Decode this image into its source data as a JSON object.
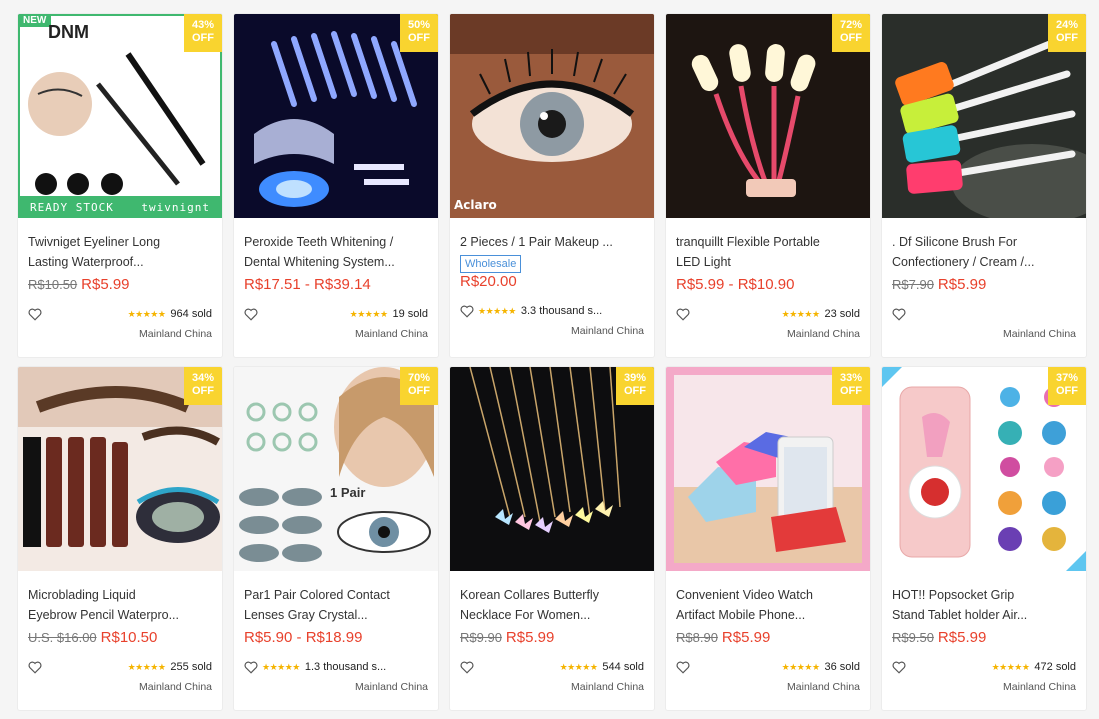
{
  "products": [
    {
      "title1": "Twivniget Eyeliner Long",
      "title2": "Lasting Waterproof...",
      "old_price": "R$10.50",
      "price": "R$5.99",
      "stars": "★★★★★",
      "sold": "964 sold",
      "origin": "Mainland China",
      "discount": [
        "43%",
        "OFF"
      ],
      "new_label": "NEW",
      "brand": "DNM",
      "banner_left": "READY STOCK",
      "banner_right": "twivnignt"
    },
    {
      "title1": "Peroxide Teeth Whitening /",
      "title2": "Dental Whitening System...",
      "old_price": "",
      "price": "R$17.51 - R$39.14",
      "stars": "★★★★★",
      "sold": "19 sold",
      "origin": "Mainland China",
      "discount": [
        "50%",
        "OFF"
      ]
    },
    {
      "title1": "2 Pieces / 1 Pair Makeup ...",
      "title2": "",
      "tag": "Wholesale",
      "old_price": "",
      "price": "R$20.00",
      "stars": "★★★★★",
      "sold": "3.3 thousand s...",
      "origin": "Mainland China",
      "discount": null,
      "image_caption": "Aclaro"
    },
    {
      "title1": "tranquillt Flexible Portable",
      "title2": "LED Light",
      "old_price": "",
      "price": "R$5.99 - R$10.90",
      "stars": "★★★★★",
      "sold": "23 sold",
      "origin": "Mainland China",
      "discount": [
        "72%",
        "OFF"
      ]
    },
    {
      "title1": ". Df Silicone Brush For",
      "title2": "Confectionery / Cream /...",
      "old_price": "R$7.90",
      "price": "R$5.99",
      "stars": "",
      "sold": "",
      "origin": "Mainland China",
      "discount": [
        "24%",
        "OFF"
      ]
    },
    {
      "title1": "Microblading Liquid",
      "title2": "Eyebrow Pencil Waterpro...",
      "old_price": "U.S. $16.00",
      "price": "R$10.50",
      "stars": "★★★★★",
      "sold": "255 sold",
      "origin": "Mainland China",
      "discount": [
        "34%",
        "OFF"
      ]
    },
    {
      "title1": "Par1 Pair Colored Contact",
      "title2": "Lenses Gray Crystal...",
      "old_price": "",
      "price": "R$5.90 - R$18.99",
      "stars": "★★★★★",
      "sold": "1.3 thousand s...",
      "origin": "Mainland China",
      "discount": [
        "70%",
        "OFF"
      ],
      "image_caption": "1 Pair"
    },
    {
      "title1": "Korean Collares Butterfly",
      "title2": "Necklace For Women...",
      "old_price": "R$9.90",
      "price": "R$5.99",
      "stars": "★★★★★",
      "sold": "544 sold",
      "origin": "Mainland China",
      "discount": [
        "39%",
        "OFF"
      ]
    },
    {
      "title1": "Convenient Video Watch",
      "title2": "Artifact Mobile Phone...",
      "old_price": "R$8.90",
      "price": "R$5.99",
      "stars": "★★★★★",
      "sold": "36 sold",
      "origin": "Mainland China",
      "discount": [
        "33%",
        "OFF"
      ]
    },
    {
      "title1": "HOT!! Popsocket Grip",
      "title2": "Stand Tablet holder Air...",
      "old_price": "R$9.50",
      "price": "R$5.99",
      "stars": "★★★★★",
      "sold": "472 sold",
      "origin": "Mainland China",
      "discount": [
        "37%",
        "OFF"
      ]
    }
  ],
  "colors": {
    "price": "#e8412c",
    "badge": "#f9d42f",
    "star": "#f5b400",
    "wholesale": "#4a90d9"
  },
  "icons": {
    "wishlist": "heart-outline-icon"
  }
}
